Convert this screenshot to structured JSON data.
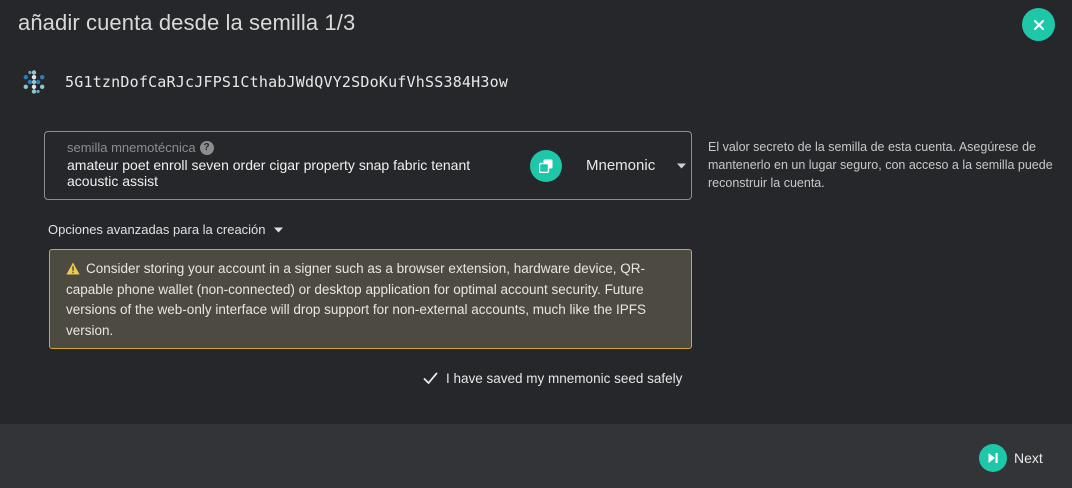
{
  "modal": {
    "title": "añadir cuenta desde la semilla 1/3"
  },
  "account": {
    "address": "5G1tznDofCaRJcJFPS1CthabJWdQVY2SDoKufVhSS384H3ow"
  },
  "seed": {
    "label": "semilla mnemotécnica",
    "help_glyph": "?",
    "value": "amateur poet enroll seven order cigar property snap fabric tenant acoustic assist",
    "type_selected": "Mnemonic",
    "help_text": "El valor secreto de la semilla de esta cuenta. Asegúrese de mantenerlo en un lugar seguro, con acceso a la semilla puede reconstruir la cuenta."
  },
  "advanced": {
    "label": "Opciones avanzadas para la creación"
  },
  "warning": {
    "text": "Consider storing your account in a signer such as a browser extension, hardware device, QR-capable phone wallet (non-connected) or desktop application for optimal account security. Future versions of the web-only interface will drop support for non-external accounts, much like the IPFS version."
  },
  "saved_checkbox": {
    "label": "I have saved my mnemonic seed safely",
    "checked": true
  },
  "footer": {
    "next_label": "Next"
  },
  "colors": {
    "accent": "#1fc7a9",
    "background": "#26272b",
    "footer": "#333438",
    "warning_border": "#d4a82c",
    "warning_bg": "#4c4a41"
  },
  "icons": {
    "close": "close-icon",
    "copy": "copy-icon",
    "dropdown": "caret-down-icon",
    "warning": "warning-triangle-icon",
    "check": "check-icon",
    "next": "step-forward-icon",
    "identicon": "identicon"
  }
}
